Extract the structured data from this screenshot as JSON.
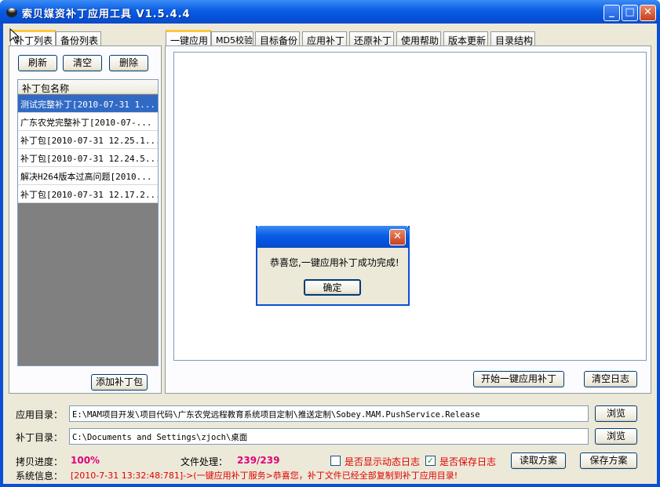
{
  "app": {
    "title": "索贝媒资补丁应用工具 V1.5.4.4"
  },
  "window_controls": {
    "minimize": "_",
    "maximize": "□",
    "close": "✕"
  },
  "left_tabs": [
    "补丁列表",
    "备份列表"
  ],
  "left_buttons": {
    "refresh": "刷新",
    "clear": "清空",
    "delete": "删除"
  },
  "patch_list": {
    "header": "补丁包名称",
    "items": [
      "测试完整补丁[2010-07-31 1...",
      "广东农党完整补丁[2010-07-...",
      "补丁包[2010-07-31 12.25.1...",
      "补丁包[2010-07-31 12.24.5...",
      "解决H264版本过高问题[2010...",
      "补丁包[2010-07-31 12.17.2..."
    ]
  },
  "add_patch_button": "添加补丁包",
  "main_tabs": [
    "一键应用",
    "MD5校验",
    "目标备份",
    "应用补丁",
    "还原补丁",
    "使用帮助",
    "版本更新",
    "目录结构"
  ],
  "main_buttons": {
    "start": "开始一键应用补丁",
    "clear_log": "清空日志"
  },
  "app_dir": {
    "label": "应用目录：",
    "value": "E:\\MAM项目开发\\项目代码\\广东农党远程教育系统项目定制\\推送定制\\Sobey.MAM.PushService.Release",
    "browse": "浏览"
  },
  "patch_dir": {
    "label": "补丁目录：",
    "value": "C:\\Documents and Settings\\zjoch\\桌面",
    "browse": "浏览"
  },
  "status": {
    "copy_progress_label": "拷贝进度：",
    "copy_progress": "100%",
    "file_proc_label": "文件处理：",
    "file_proc": "239/239",
    "show_log_label": "是否显示动态日志",
    "show_log_checked": false,
    "save_log_label": "是否保存日志",
    "save_log_checked": true,
    "read_button": "读取方案",
    "save_button": "保存方案",
    "sysinfo_label": "系统信息：",
    "sysinfo": "[2010-7-31 13:32:48:781]->(一键应用补丁服务>恭喜您，补丁文件已经全部复制到补丁应用目录!"
  },
  "dialog": {
    "message": "恭喜您,一键应用补丁成功完成!",
    "ok": "确定",
    "close": "✕"
  },
  "colors": {
    "titlebar": "#0a5ce3",
    "selection": "#316ac5",
    "accent_red": "#e00000",
    "progress_pink": "#e0007a"
  }
}
